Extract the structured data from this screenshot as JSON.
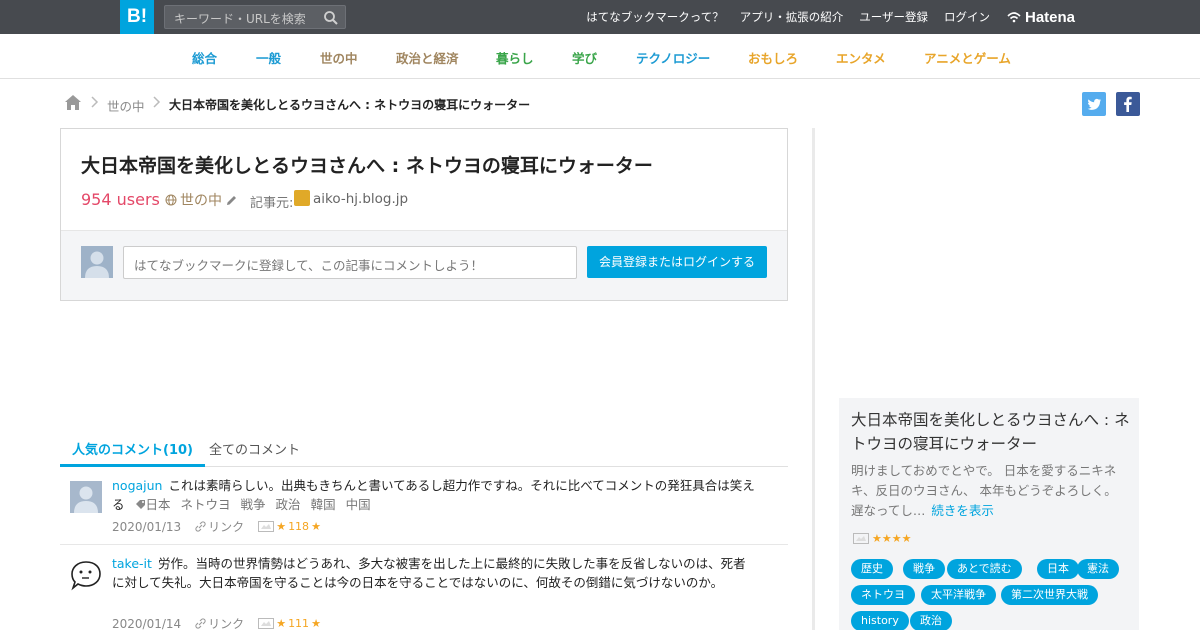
{
  "topbar": {
    "logo": "B!",
    "search_placeholder": "キーワード・URLを検索",
    "links": [
      "はてなブックマークって？",
      "アプリ・拡張の紹介",
      "ユーザー登録",
      "ログイン"
    ],
    "brand": "Hatena"
  },
  "categories": [
    {
      "label": "総合",
      "color": "#1d9bd3"
    },
    {
      "label": "一般",
      "color": "#1d9bd3"
    },
    {
      "label": "世の中",
      "color": "#a08660"
    },
    {
      "label": "政治と経済",
      "color": "#a08660"
    },
    {
      "label": "暮らし",
      "color": "#3aa54a"
    },
    {
      "label": "学び",
      "color": "#3aa54a"
    },
    {
      "label": "テクノロジー",
      "color": "#1d9bd3"
    },
    {
      "label": "おもしろ",
      "color": "#e8a52a"
    },
    {
      "label": "エンタメ",
      "color": "#e8a52a"
    },
    {
      "label": "アニメとゲーム",
      "color": "#e8a52a"
    }
  ],
  "breadcrumb": {
    "category": "世の中",
    "title": "大日本帝国を美化しとるウヨさんへ : ネトウヨの寝耳にウォーター"
  },
  "entry": {
    "title": "大日本帝国を美化しとるウヨさんへ : ネトウヨの寝耳にウォーター",
    "users": "954 users",
    "category": "世の中",
    "source_label": "記事元:",
    "source_domain": "aiko-hj.blog.jp",
    "comment_placeholder": "はてなブックマークに登録して、この記事にコメントしよう！",
    "login_button": "会員登録またはログインする"
  },
  "tabs": {
    "popular": "人気のコメント(10)",
    "all": "全てのコメント"
  },
  "comments": [
    {
      "user": "nogajun",
      "text": "これは素晴らしい。出典もきちんと書いてあるし超力作ですね。それに比べてコメントの発狂具合は笑える",
      "tags": [
        "日本",
        "ネトウヨ",
        "戦争",
        "政治",
        "韓国",
        "中国"
      ],
      "date": "2020/01/13",
      "link": "リンク",
      "stars": "118"
    },
    {
      "user": "take-it",
      "text": "労作。当時の世界情勢はどうあれ、多大な被害を出した上に最終的に失敗した事を反省しないのは、死者に対して失礼。大日本帝国を守ることは今の日本を守ることではないのに、何故その倒錯に気づけないのか。",
      "tags": [],
      "date": "2020/01/14",
      "link": "リンク",
      "stars": "111"
    }
  ],
  "sidebar": {
    "title": "大日本帝国を美化しとるウヨさんへ : ネトウヨの寝耳にウォーター",
    "summary": "明けましておめでとやで。 日本を愛するニキネキ、反日のウヨさん、 本年もどうぞよろしく。 遅なってし…",
    "more": "続きを表示",
    "stars": "★★★★",
    "tags": [
      "歴史",
      "戦争",
      "あとで読む",
      "日本",
      "憲法",
      "ネトウヨ",
      "太平洋戦争",
      "第二次世界大戦",
      "history",
      "政治"
    ]
  },
  "colors": {
    "accent": "#00a4de",
    "users": "#e44868",
    "topbar": "#474a4f",
    "star": "#f5a623"
  }
}
